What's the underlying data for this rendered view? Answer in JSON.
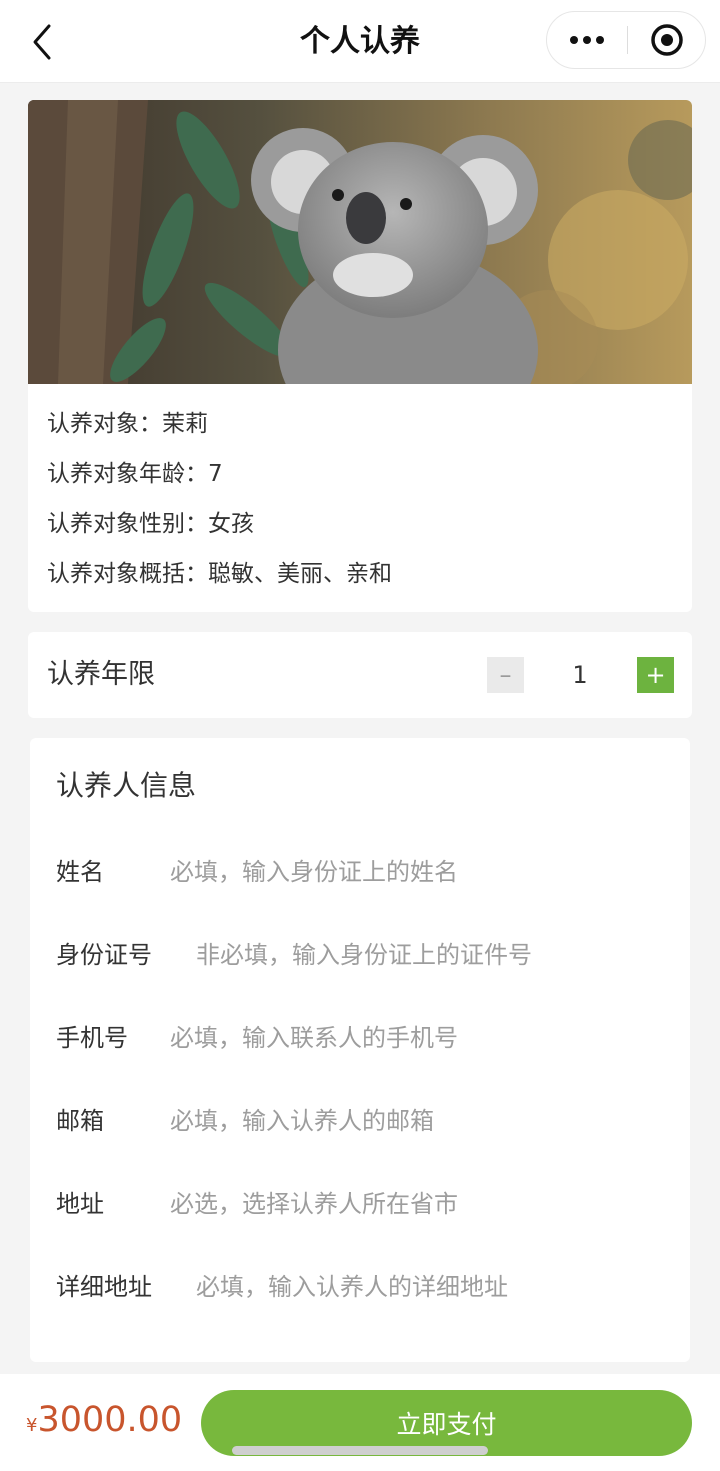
{
  "nav": {
    "title": "个人认养"
  },
  "animal": {
    "photo_subject": "koala-photo",
    "lines": [
      "认养对象：茉莉",
      "认养对象年龄：7",
      "认养对象性别：女孩",
      "认养对象概括：聪敏、美丽、亲和"
    ]
  },
  "years": {
    "label": "认养年限",
    "minus": "–",
    "value": "1",
    "plus": "+"
  },
  "form": {
    "title": "认养人信息",
    "fields": [
      {
        "label": "姓名",
        "placeholder": "必填，输入身份证上的姓名"
      },
      {
        "label": "身份证号",
        "placeholder": "非必填，输入身份证上的证件号"
      },
      {
        "label": "手机号",
        "placeholder": "必填，输入联系人的手机号"
      },
      {
        "label": "邮箱",
        "placeholder": "必填，输入认养人的邮箱"
      },
      {
        "label": "地址",
        "placeholder": "必选，选择认养人所在省市"
      },
      {
        "label": "详细地址",
        "placeholder": "必填，输入认养人的详细地址"
      }
    ]
  },
  "footer": {
    "currency": "¥",
    "price": "3000.00",
    "pay_label": "立即支付"
  },
  "colors": {
    "accent_green": "#78b83d",
    "price_red": "#c8552d"
  }
}
